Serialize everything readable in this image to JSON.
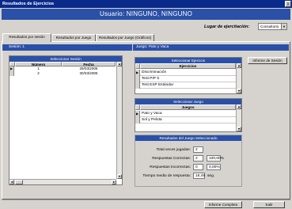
{
  "window": {
    "title": "Resultados de Ejercicios",
    "close_glyph": "X"
  },
  "banner": {
    "text": "Usuario:  NINGUNO,  NINGUNO"
  },
  "lugar": {
    "label": "Lugar de ejercitación:",
    "value": "Consultorio",
    "arrow": "▼"
  },
  "tabs": [
    {
      "label": "Resultados por sesión",
      "active": true
    },
    {
      "label": "Resultados por Juego",
      "active": false
    },
    {
      "label": "Resultados por Juego (Gráficos)",
      "active": false
    }
  ],
  "info": {
    "sesion": "Sesión:  1",
    "juego": "Juego:  Pato y Vaca"
  },
  "sesiones": {
    "title": "Seleccionar Sesión",
    "columns": [
      "Número",
      "Fecha"
    ],
    "rows": [
      {
        "numero": "1",
        "fecha": "29/03/2005"
      },
      {
        "numero": "2",
        "fecha": "30/03/2005"
      }
    ]
  },
  "ejercicios": {
    "title": "Seleccionar Ejercicio",
    "column": "Ejercicios",
    "items": [
      "Discriminación",
      "Test PIP S",
      "Test ESP Estándar"
    ]
  },
  "juegos": {
    "title": "Seleccionar Juego",
    "column": "Juegos",
    "items": [
      "Pato y Vaca",
      "Sol y Pelota"
    ]
  },
  "resultados": {
    "title": "Resultados del Juego Seleccionado",
    "total_label": "Total veces jugadas:",
    "total_value": "2",
    "correctas_label": "Respuestas Correctas:",
    "correctas_value": "2",
    "correctas_pct": "100,00%",
    "incorrectas_label": "Respuestas Incorrectas:",
    "incorrectas_value": "0",
    "incorrectas_pct": "0,00%",
    "tiempo_label": "Tiempo medio de respuesta:",
    "tiempo_value": "16,49",
    "tiempo_unit": "seg."
  },
  "buttons": {
    "informe_sesion": "Informe de Sesión",
    "informe_completo": "Informe Completo",
    "salir": "Salir"
  },
  "glyphs": {
    "up": "▲",
    "down": "▼",
    "left": "◄",
    "right": "►",
    "current": "▶"
  }
}
